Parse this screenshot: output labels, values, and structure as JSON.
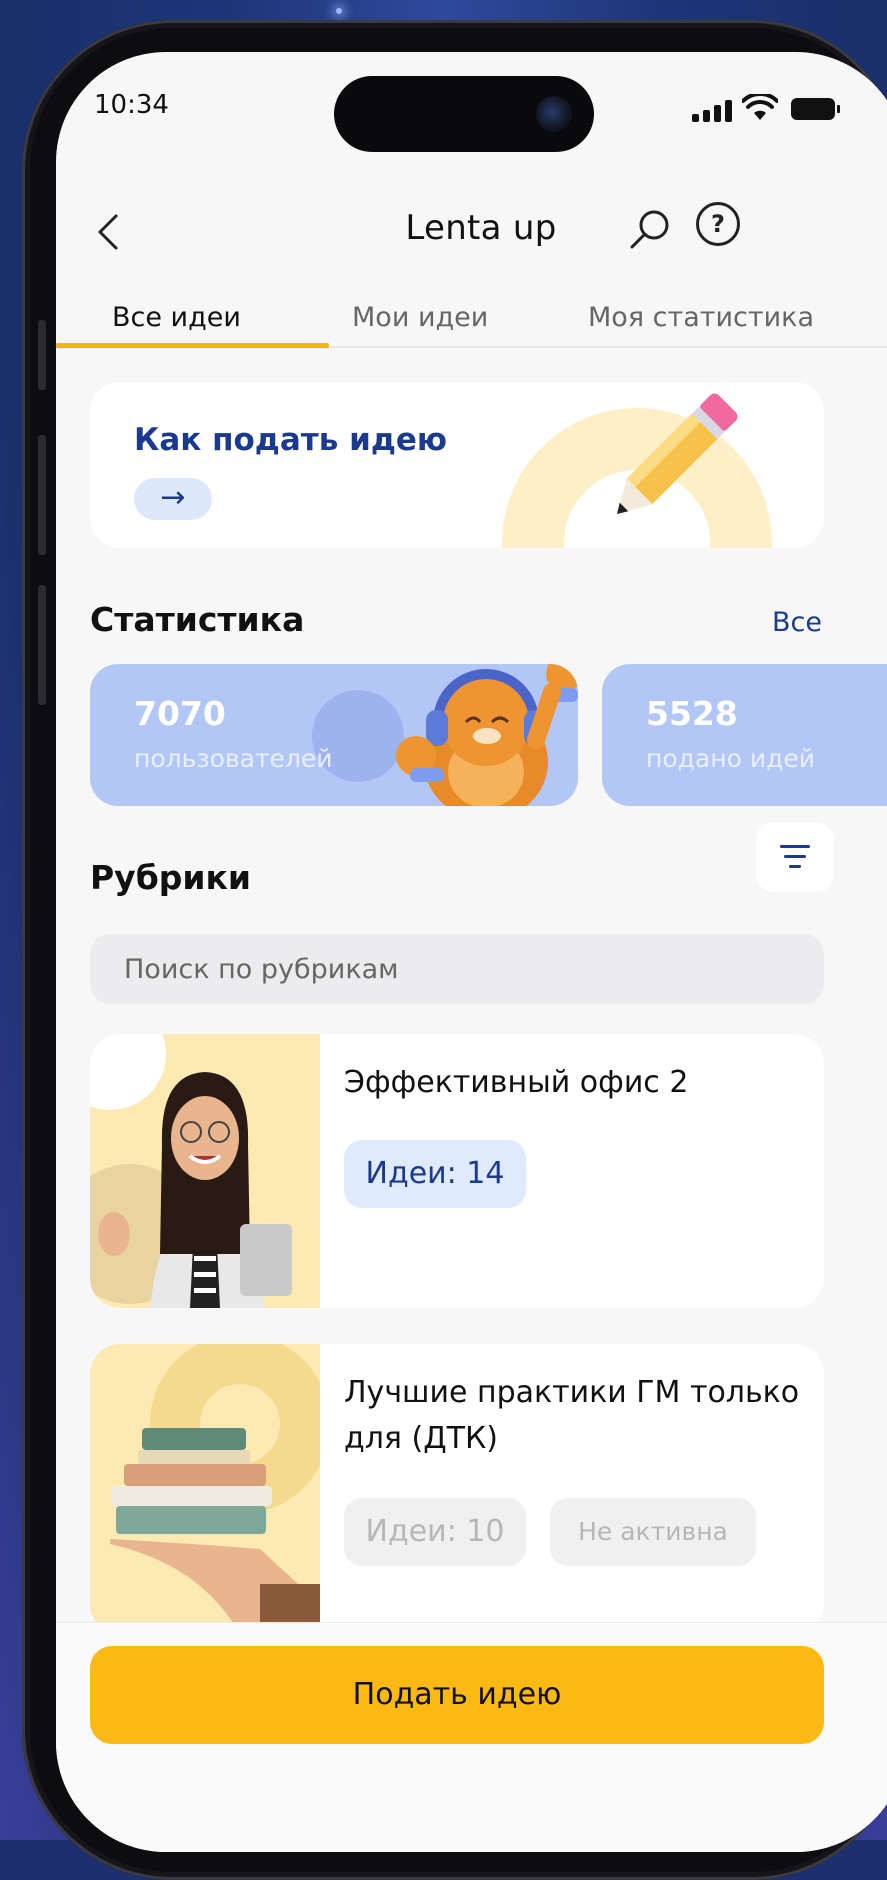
{
  "status_bar": {
    "time": "10:34"
  },
  "header": {
    "title": "Lenta up"
  },
  "tabs": [
    {
      "label": "Все идеи",
      "active": true
    },
    {
      "label": "Мои идеи",
      "active": false
    },
    {
      "label": "Моя статистика",
      "active": false
    }
  ],
  "howto": {
    "title": "Как подать идею",
    "arrow": "→"
  },
  "statistics": {
    "title": "Статистика",
    "see_all": "Все",
    "cards": [
      {
        "value": "7070",
        "label": "пользователей"
      },
      {
        "value": "5528",
        "label": "подано идей"
      }
    ]
  },
  "rubrics": {
    "title": "Рубрики",
    "search_placeholder": "Поиск по рубрикам",
    "items": [
      {
        "title": "Эффективный офис 2",
        "ideas": "Идеи: 14",
        "status": "",
        "active": true
      },
      {
        "title": "Лучшие практики ГМ только для (ДТК)",
        "ideas": "Идеи: 10",
        "status": "Не активна",
        "active": false
      }
    ]
  },
  "cta": {
    "label": "Подать идею"
  },
  "colors": {
    "accent": "#fdb913",
    "brand_blue": "#1a3a8f",
    "stat_card": "#b3c7f7"
  },
  "icons": [
    "back-icon",
    "search-icon",
    "help-icon",
    "arrow-right-icon",
    "filter-icon",
    "pencil-icon"
  ]
}
